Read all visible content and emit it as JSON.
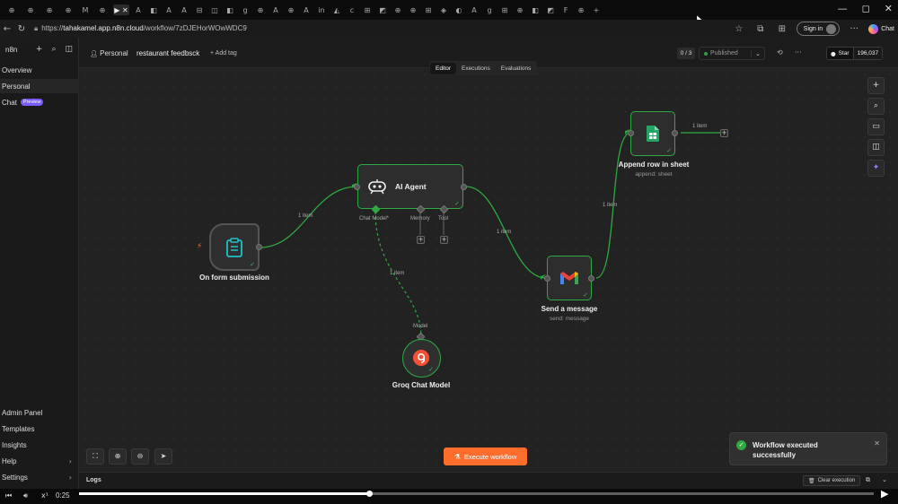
{
  "browser": {
    "tabs": [
      "⊕",
      "⊕",
      "⊕",
      "⊕",
      "M",
      "⊕",
      "▶ ✕",
      "A",
      "◧",
      "A",
      "A",
      "⊟",
      "◫",
      "◧",
      "g",
      "⊕",
      "A",
      "⊕",
      "A",
      "in",
      "◭",
      "c",
      "⊞",
      "◩",
      "⊕",
      "⊕",
      "⊞",
      "◈",
      "◐",
      "A",
      "g",
      "⊞",
      "⊕",
      "◧",
      "◩",
      "F",
      "⊕",
      "+"
    ],
    "window_controls": [
      "—",
      "◻",
      "✕"
    ],
    "url_prefix": "https://",
    "url_host": "tahakamel.app.n8n.cloud",
    "url_path": "/workflow/7zDJEHorWOwWDC9",
    "signin_label": "Sign in",
    "chat_label": "Chat",
    "more": "···"
  },
  "sidebar": {
    "logo": "n8n",
    "items": [
      "Overview",
      "Personal",
      "Chat"
    ],
    "preview_badge": "Preview",
    "bottom_items": [
      "Admin Panel",
      "Templates",
      "Insights",
      "Help",
      "Settings"
    ],
    "chevron": "›"
  },
  "header": {
    "project": "Personal",
    "workflow_name": "restaurant feedbsck",
    "add_tag": "+ Add tag",
    "tabs": [
      "Editor",
      "Executions",
      "Evaluations"
    ],
    "active_tab": "Editor",
    "counter": "0 / 3",
    "status": "Published",
    "star_label": "Star",
    "star_count": "196,037"
  },
  "nodes": {
    "form_trigger": {
      "title": "On form submission",
      "icon": "clipboard-icon",
      "color": "#20c1c9"
    },
    "ai_agent": {
      "title": "AI Agent",
      "icon": "robot-icon",
      "ports": [
        "Chat Model*",
        "Memory",
        "Tool"
      ]
    },
    "gmail": {
      "title": "Send a message",
      "subtitle": "send: message",
      "icon": "gmail-icon"
    },
    "sheets": {
      "title": "Append row in sheet",
      "subtitle": "append: sheet",
      "icon": "google-sheets-icon",
      "color": "#23a566"
    },
    "groq": {
      "title": "Groq Chat Model",
      "port": "Model",
      "icon": "groq-icon",
      "color": "#f55036"
    }
  },
  "edges": {
    "form_to_agent": "1 item",
    "agent_to_gmail": "1 item",
    "gmail_to_sheets": "1 item",
    "sheets_out": "1 item",
    "groq_to_agent": "1 item"
  },
  "canvas": {
    "execute_label": "Execute workflow",
    "toast_message": "Workflow executed successfully"
  },
  "logs": {
    "title": "Logs",
    "clear_label": "Clear execution"
  },
  "player": {
    "time": "0:25",
    "speed": "x¹",
    "progress": 0.365
  },
  "colors": {
    "edge": "#2faa43",
    "accent": "#ff6d2d",
    "preview": "#7c5cff"
  }
}
